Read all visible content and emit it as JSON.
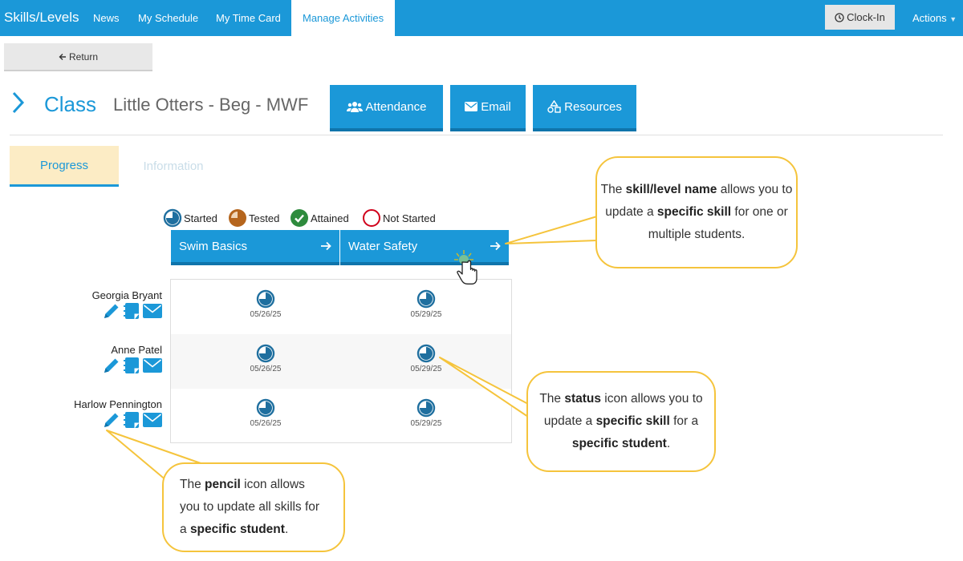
{
  "nav": {
    "brand": "Skills/Levels",
    "links": [
      "News",
      "My Schedule",
      "My Time Card",
      "Manage Activities"
    ],
    "clock_in": "Clock-In",
    "actions": "Actions"
  },
  "return_label": "Return",
  "class_header": {
    "label": "Class",
    "name": "Little Otters - Beg - MWF",
    "buttons": [
      "Attendance",
      "Email",
      "Resources"
    ]
  },
  "tabs": [
    "Progress",
    "Information"
  ],
  "legend": [
    "Started",
    "Tested",
    "Attained",
    "Not Started"
  ],
  "skills": [
    "Swim Basics",
    "Water Safety"
  ],
  "students": [
    {
      "name": "Georgia Bryant",
      "dates": [
        "05/26/25",
        "05/29/25"
      ]
    },
    {
      "name": "Anne Patel",
      "dates": [
        "05/26/25",
        "05/29/25"
      ]
    },
    {
      "name": "Harlow Pennington",
      "dates": [
        "05/26/25",
        "05/29/25"
      ]
    }
  ],
  "callouts": {
    "skill": {
      "t1": "The ",
      "b1": "skill/level name",
      "t2": " allows you to update a ",
      "b2": "specific skill",
      "t3": " for one or multiple students."
    },
    "status": {
      "t1": "The ",
      "b1": "status",
      "t2": " icon allows you to update a ",
      "b2": "specific skill",
      "t3": " for a ",
      "b3": "specific student",
      "t4": "."
    },
    "pencil": {
      "t1": "The ",
      "b1": "pencil",
      "t2": " icon allows you to update all skills for a ",
      "b2": "specific student",
      "t3": "."
    }
  },
  "colors": {
    "primary": "#1b98d8",
    "primary_dark": "#0f74ab",
    "tab_highlight": "#fcecc5",
    "callout_border": "#f5c43c",
    "tested": "#b5651d",
    "attained": "#2e8b3d",
    "not_started": "#d0021b"
  },
  "icons": {
    "return": "arrow-left-icon",
    "clock": "clock-icon",
    "attendance": "users-icon",
    "email": "envelope-icon",
    "resources": "shapes-icon",
    "skill_link": "arrow-right-icon",
    "student_edit": "pencil-icon",
    "student_notes": "notes-icon",
    "student_email": "envelope-icon",
    "status_started": "pie-quarter-icon"
  }
}
